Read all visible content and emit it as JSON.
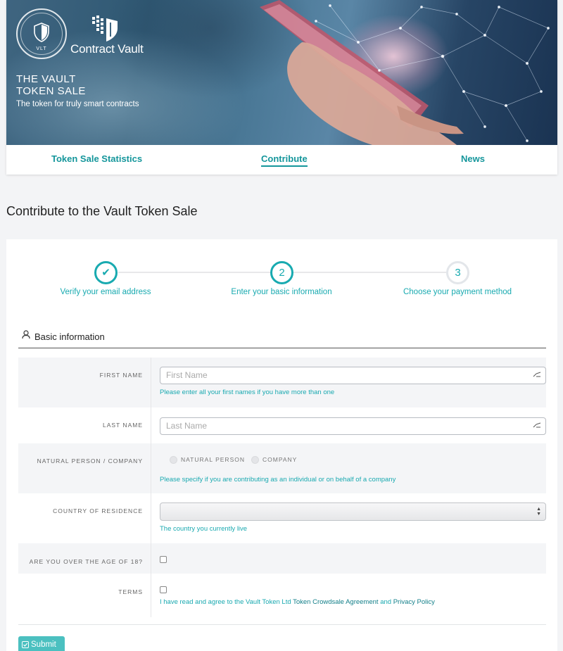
{
  "hero": {
    "badge_text": "VLT",
    "brand_name": "Contract Vault",
    "title_line1": "THE VAULT",
    "title_line2": "TOKEN SALE",
    "subtitle": "The token for truly smart contracts"
  },
  "nav": {
    "items": [
      {
        "label": "Token Sale Statistics"
      },
      {
        "label": "Contribute",
        "active": true
      },
      {
        "label": "News"
      }
    ]
  },
  "page": {
    "title": "Contribute to the Vault Token Sale"
  },
  "stepper": {
    "steps": [
      {
        "marker": "✔",
        "label": "Verify your email address",
        "state": "done"
      },
      {
        "marker": "2",
        "label": "Enter your basic information",
        "state": "current"
      },
      {
        "marker": "3",
        "label": "Choose your payment method",
        "state": "pending"
      }
    ]
  },
  "section": {
    "title": "Basic information",
    "icon": "user-icon"
  },
  "form": {
    "first_name": {
      "label": "FIRST NAME",
      "placeholder": "First Name",
      "help": "Please enter all your first names if you have more than one"
    },
    "last_name": {
      "label": "LAST NAME",
      "placeholder": "Last Name"
    },
    "person_type": {
      "label": "NATURAL PERSON / COMPANY",
      "options": [
        "NATURAL PERSON",
        "COMPANY"
      ],
      "help": "Please specify if you are contributing as an individual or on behalf of a company"
    },
    "country": {
      "label": "COUNTRY OF RESIDENCE",
      "value": "",
      "help": "The country you currently live"
    },
    "age": {
      "label": "ARE YOU OVER THE AGE OF 18?",
      "checked": false
    },
    "terms": {
      "label": "TERMS",
      "checked": false,
      "text_before": "I have read and agree to the Vault Token Ltd ",
      "link1": "Token Crowdsale Agreement",
      "text_mid": " and ",
      "link2": "Privacy Policy"
    }
  },
  "submit_label": "Submit",
  "colors": {
    "accent": "#18aab0",
    "nav_text": "#14969b",
    "button": "#4bc0c0"
  }
}
